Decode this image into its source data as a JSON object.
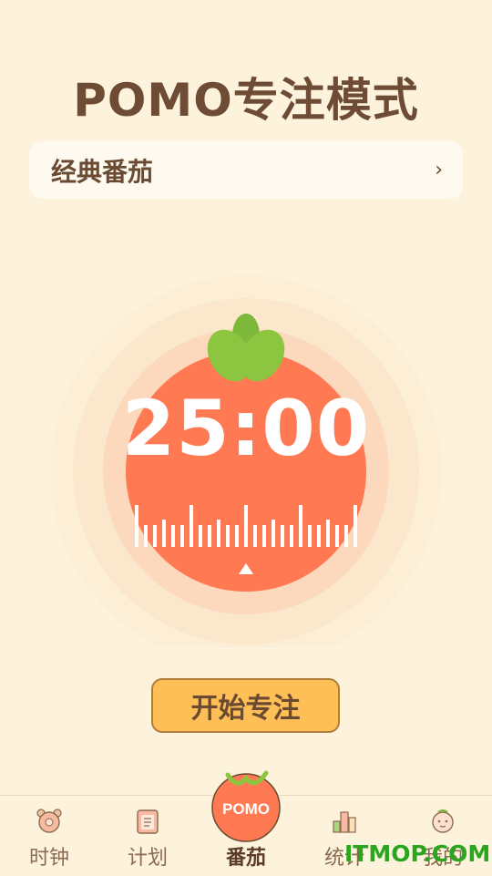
{
  "header": {
    "title": "POMO专注模式"
  },
  "mode_selector": {
    "label": "经典番茄",
    "chevron": "›"
  },
  "timer": {
    "time": "25:00"
  },
  "actions": {
    "start_label": "开始专注"
  },
  "tabbar": {
    "items": [
      {
        "label": "时钟",
        "icon": "alarm-clock-icon"
      },
      {
        "label": "计划",
        "icon": "notebook-icon"
      },
      {
        "label": "番茄",
        "icon": "tomato-icon",
        "active": true
      },
      {
        "label": "统计",
        "icon": "bar-chart-icon"
      },
      {
        "label": "我的",
        "icon": "profile-icon"
      }
    ],
    "center_badge": "POMO"
  },
  "watermark": "ITMOP.COM",
  "colors": {
    "background": "#fdf2dc",
    "tomato": "#ff7a52",
    "leaf": "#8cc540",
    "button": "#ffbf57",
    "text": "#6b4a32"
  }
}
